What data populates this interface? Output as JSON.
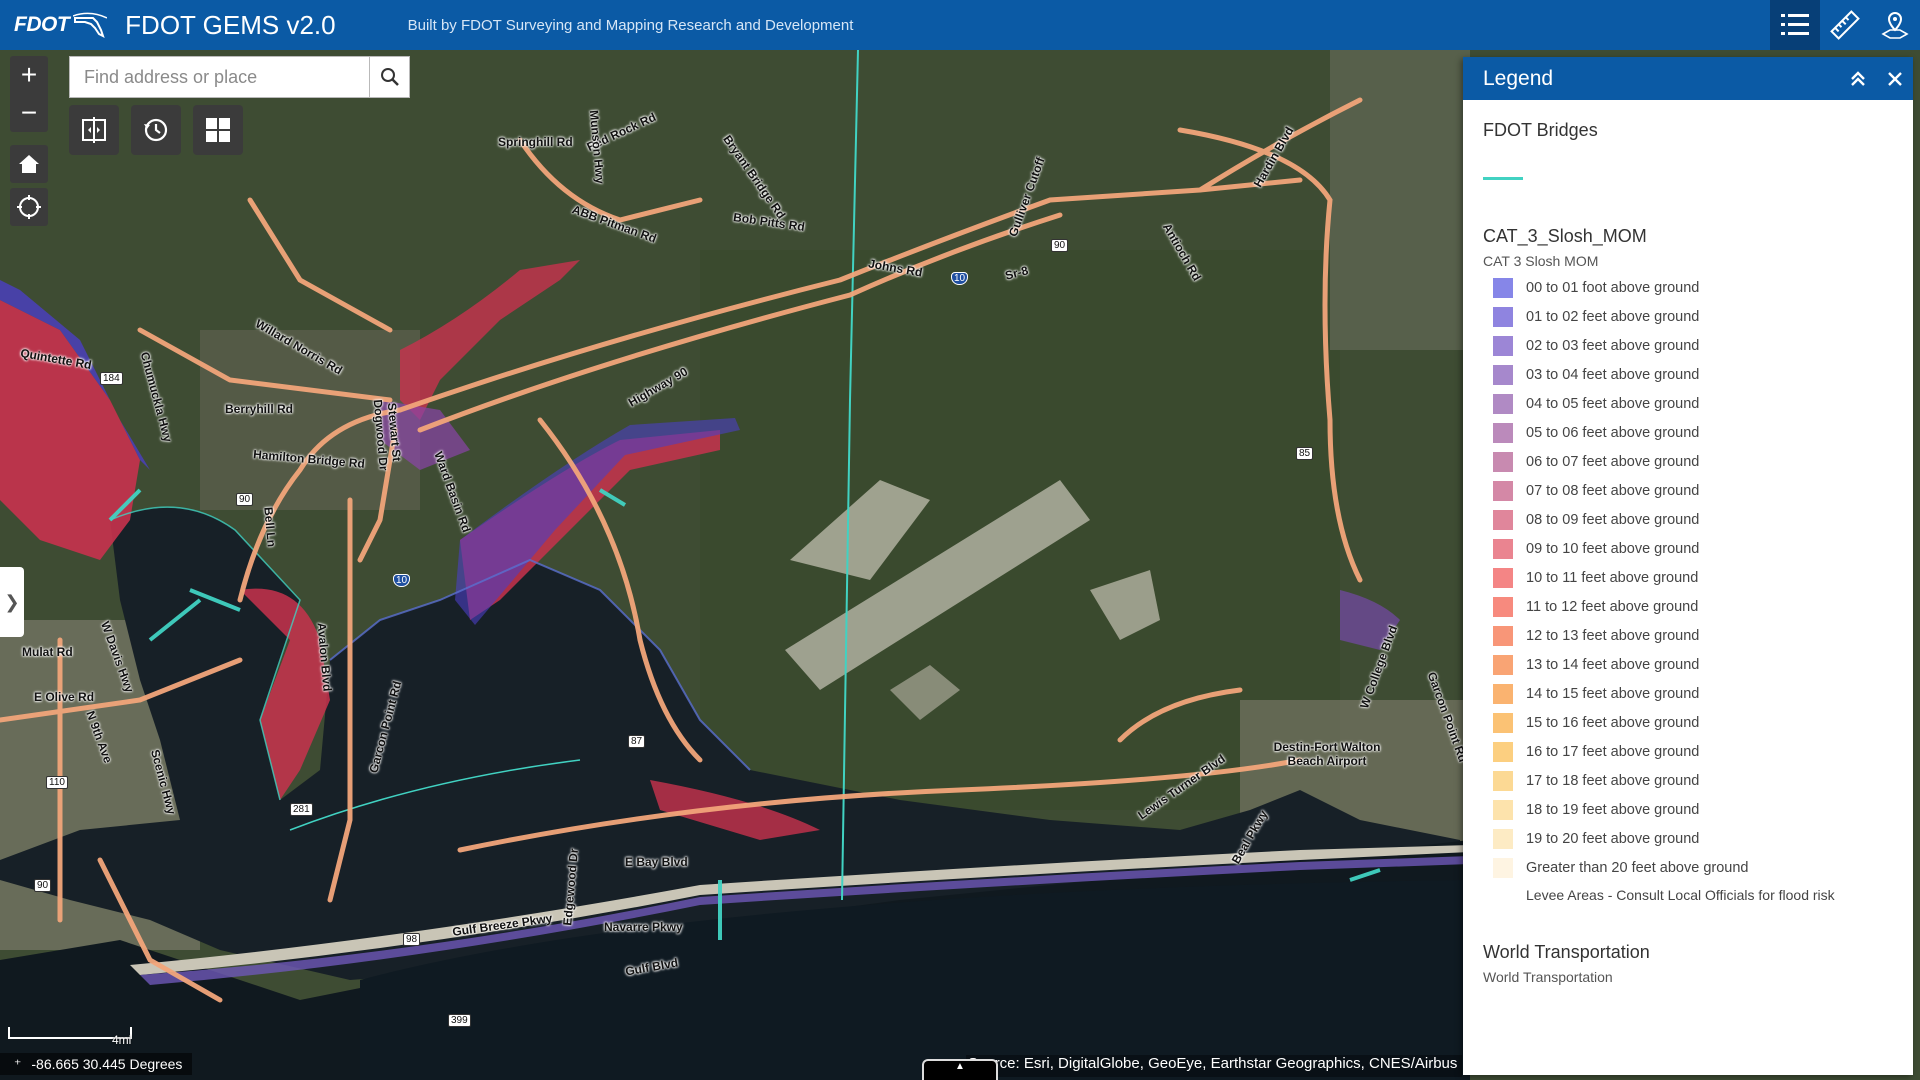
{
  "header": {
    "logo_text": "FDOT",
    "title": "FDOT GEMS v2.0",
    "subtitle": "Built by FDOT Surveying and Mapping Research and Development"
  },
  "search": {
    "placeholder": "Find address or place"
  },
  "map": {
    "scale_label": "4mi",
    "coordinates": "-86.665 30.445 Degrees",
    "attribution": "Source: Esri, DigitalGlobe, GeoEye, Earthstar Geographics, CNES/Airbus DS",
    "road_labels": [
      "Springhill Rd",
      "Red Rock Rd",
      "Munson Hwy",
      "Bryant Bridge Rd",
      "Hardin Blvd",
      "ABB Pitman Rd",
      "Bob Pitts Rd",
      "Johns Rd",
      "Sr-8",
      "Gulliver Cutoff",
      "Antioch Rd",
      "Quintette Rd",
      "Chumuckla Hwy",
      "Willard Norris Rd",
      "Berryhill Rd",
      "Hamilton Bridge Rd",
      "Stewart St",
      "Dogwood Dr",
      "Highway 90",
      "Ward Basin Rd",
      "Bell Ln",
      "Avalon Blvd",
      "Garcon Point Rd",
      "Mulat Rd",
      "E Olive Rd",
      "W Davis Hwy",
      "N 9th Ave",
      "Scenic Hwy",
      "Edgewood Dr",
      "E Bay Blvd",
      "Gulf Breeze Pkwy",
      "Navarre Pkwy",
      "Lewis Turner Blvd",
      "Destin-Fort Walton Beach Airport",
      "W College Blvd",
      "Beal Pkwy",
      "Garcon Point Rd",
      "Gulf Blvd"
    ],
    "route_shields": [
      "184",
      "90",
      "10",
      "110",
      "281",
      "87",
      "90",
      "98",
      "399",
      "85",
      "10",
      "90"
    ]
  },
  "legend": {
    "title": "Legend",
    "layers": [
      {
        "title": "FDOT Bridges"
      },
      {
        "title": "CAT_3_Slosh_MOM",
        "subtitle": "CAT 3 Slosh MOM",
        "items": [
          {
            "label": "00 to 01 foot above ground",
            "color": "#8686e8"
          },
          {
            "label": "01 to 02 feet above ground",
            "color": "#8f84e0"
          },
          {
            "label": "02 to 03 feet above ground",
            "color": "#9c86d6"
          },
          {
            "label": "03 to 04 feet above ground",
            "color": "#a688cc"
          },
          {
            "label": "04 to 05 feet above ground",
            "color": "#b08ac4"
          },
          {
            "label": "05 to 06 feet above ground",
            "color": "#bb8abb"
          },
          {
            "label": "06 to 07 feet above ground",
            "color": "#c88ab0"
          },
          {
            "label": "07 to 08 feet above ground",
            "color": "#d488a6"
          },
          {
            "label": "08 to 09 feet above ground",
            "color": "#e0869b"
          },
          {
            "label": "09 to 10 feet above ground",
            "color": "#ea8490"
          },
          {
            "label": "10 to 11 feet above ground",
            "color": "#f48585"
          },
          {
            "label": "11 to 12 feet above ground",
            "color": "#f78a7e"
          },
          {
            "label": "12 to 13 feet above ground",
            "color": "#f89678"
          },
          {
            "label": "13 to 14 feet above ground",
            "color": "#f9a474"
          },
          {
            "label": "14 to 15 feet above ground",
            "color": "#fab370"
          },
          {
            "label": "15 to 16 feet above ground",
            "color": "#fbc274"
          },
          {
            "label": "16 to 17 feet above ground",
            "color": "#fccf80"
          },
          {
            "label": "17 to 18 feet above ground",
            "color": "#fcd994"
          },
          {
            "label": "18 to 19 feet above ground",
            "color": "#fde3ac"
          },
          {
            "label": "19 to 20 feet above ground",
            "color": "#fdebc4"
          },
          {
            "label": "Greater than 20 feet above ground",
            "color": "#fef4e2"
          },
          {
            "label": "Levee Areas - Consult Local Officials for flood risk",
            "color": "#ffffff"
          }
        ]
      },
      {
        "title": "World Transportation",
        "subtitle": "World Transportation"
      }
    ]
  },
  "colors": {
    "header_bg": "#0b5aa5",
    "bridge_line": "#41d2c2",
    "surge_red": "#c8324e",
    "surge_blue": "#5a4fd0",
    "road_orange": "#f2a57a"
  },
  "icons": [
    "legend-list-icon",
    "measure-ruler-icon",
    "location-pin-icon",
    "search-icon",
    "swipe-compare-icon",
    "history-icon",
    "grid-basemap-icon",
    "home-icon",
    "locate-icon",
    "chevron-right-icon",
    "collapse-up-icon",
    "close-icon"
  ]
}
